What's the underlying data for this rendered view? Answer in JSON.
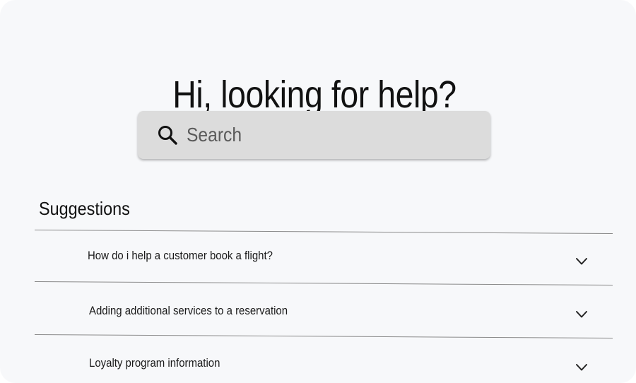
{
  "header": {
    "title": "Hi, looking for help?"
  },
  "search": {
    "placeholder": "Search",
    "value": "",
    "icon": "search-icon"
  },
  "suggestions": {
    "title": "Suggestions",
    "items": [
      {
        "label": "How do i help a customer book a flight?",
        "icon": "chevron-down-icon",
        "expanded": false
      },
      {
        "label": "Adding additional services to a reservation",
        "icon": "chevron-down-icon",
        "expanded": false
      },
      {
        "label": "Loyalty program information",
        "icon": "chevron-down-icon",
        "expanded": false
      }
    ]
  },
  "colors": {
    "background": "#f7f8fa",
    "search_box": "#dcdcdc",
    "text": "#111111",
    "divider": "#8a8a8a"
  }
}
